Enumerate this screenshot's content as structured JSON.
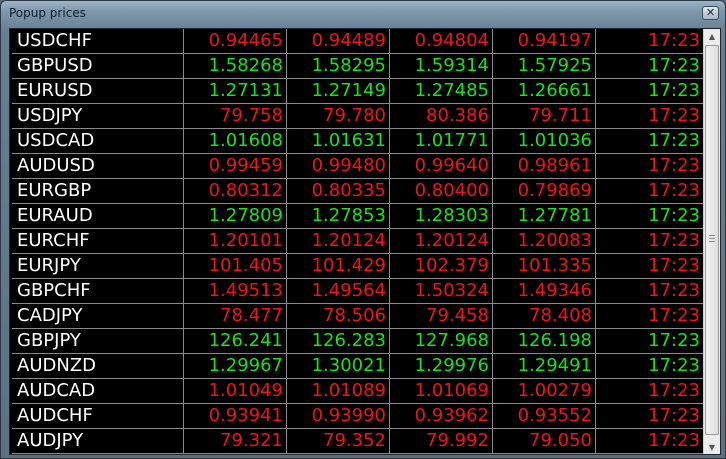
{
  "window": {
    "title": "Popup prices",
    "close_glyph": "✕",
    "up_color": "#1ee11e",
    "down_color": "#ee1616"
  },
  "scrollbar": {
    "up_arrow": "▲",
    "down_arrow": "▼"
  },
  "rows": [
    {
      "symbol": "USDCHF",
      "p1": "0.94465",
      "p2": "0.94489",
      "p3": "0.94804",
      "p4": "0.94197",
      "time": "17:23",
      "direction": "down"
    },
    {
      "symbol": "GBPUSD",
      "p1": "1.58268",
      "p2": "1.58295",
      "p3": "1.59314",
      "p4": "1.57925",
      "time": "17:23",
      "direction": "up"
    },
    {
      "symbol": "EURUSD",
      "p1": "1.27131",
      "p2": "1.27149",
      "p3": "1.27485",
      "p4": "1.26661",
      "time": "17:23",
      "direction": "up"
    },
    {
      "symbol": "USDJPY",
      "p1": "79.758",
      "p2": "79.780",
      "p3": "80.386",
      "p4": "79.711",
      "time": "17:23",
      "direction": "down"
    },
    {
      "symbol": "USDCAD",
      "p1": "1.01608",
      "p2": "1.01631",
      "p3": "1.01771",
      "p4": "1.01036",
      "time": "17:23",
      "direction": "up"
    },
    {
      "symbol": "AUDUSD",
      "p1": "0.99459",
      "p2": "0.99480",
      "p3": "0.99640",
      "p4": "0.98961",
      "time": "17:23",
      "direction": "down"
    },
    {
      "symbol": "EURGBP",
      "p1": "0.80312",
      "p2": "0.80335",
      "p3": "0.80400",
      "p4": "0.79869",
      "time": "17:23",
      "direction": "down"
    },
    {
      "symbol": "EURAUD",
      "p1": "1.27809",
      "p2": "1.27853",
      "p3": "1.28303",
      "p4": "1.27781",
      "time": "17:23",
      "direction": "up"
    },
    {
      "symbol": "EURCHF",
      "p1": "1.20101",
      "p2": "1.20124",
      "p3": "1.20124",
      "p4": "1.20083",
      "time": "17:23",
      "direction": "down"
    },
    {
      "symbol": "EURJPY",
      "p1": "101.405",
      "p2": "101.429",
      "p3": "102.379",
      "p4": "101.335",
      "time": "17:23",
      "direction": "down"
    },
    {
      "symbol": "GBPCHF",
      "p1": "1.49513",
      "p2": "1.49564",
      "p3": "1.50324",
      "p4": "1.49346",
      "time": "17:23",
      "direction": "down"
    },
    {
      "symbol": "CADJPY",
      "p1": "78.477",
      "p2": "78.506",
      "p3": "79.458",
      "p4": "78.408",
      "time": "17:23",
      "direction": "down"
    },
    {
      "symbol": "GBPJPY",
      "p1": "126.241",
      "p2": "126.283",
      "p3": "127.968",
      "p4": "126.198",
      "time": "17:23",
      "direction": "up"
    },
    {
      "symbol": "AUDNZD",
      "p1": "1.29967",
      "p2": "1.30021",
      "p3": "1.29976",
      "p4": "1.29491",
      "time": "17:23",
      "direction": "up"
    },
    {
      "symbol": "AUDCAD",
      "p1": "1.01049",
      "p2": "1.01089",
      "p3": "1.01069",
      "p4": "1.00279",
      "time": "17:23",
      "direction": "down"
    },
    {
      "symbol": "AUDCHF",
      "p1": "0.93941",
      "p2": "0.93990",
      "p3": "0.93962",
      "p4": "0.93552",
      "time": "17:23",
      "direction": "down"
    },
    {
      "symbol": "AUDJPY",
      "p1": "79.321",
      "p2": "79.352",
      "p3": "79.992",
      "p4": "79.050",
      "time": "17:23",
      "direction": "down"
    }
  ]
}
